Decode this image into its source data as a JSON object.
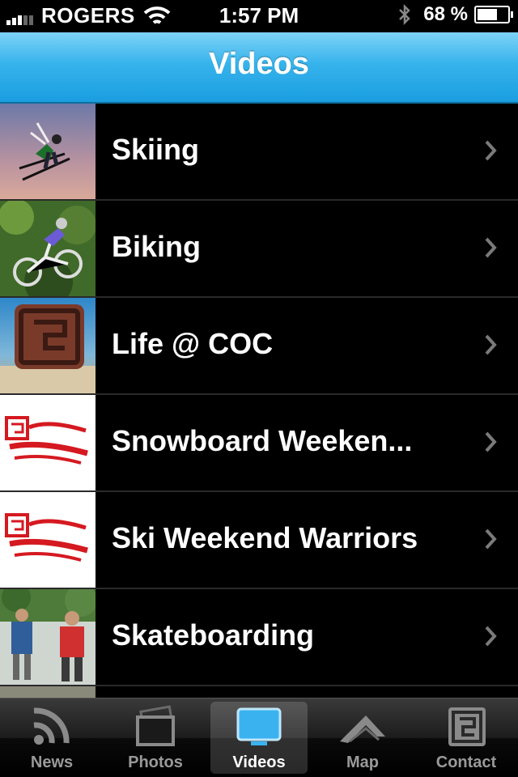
{
  "status_bar": {
    "carrier": "ROGERS",
    "time": "1:57 PM",
    "battery_percent": "68 %",
    "battery_level": 0.68
  },
  "nav": {
    "title": "Videos"
  },
  "list": {
    "items": [
      {
        "label": "Skiing",
        "thumbnail": "skier-jump-photo"
      },
      {
        "label": "Biking",
        "thumbnail": "mountain-biker-photo"
      },
      {
        "label": "Life @ COC",
        "thumbnail": "coc-logo-sign-photo"
      },
      {
        "label": "Snowboard Weeken...",
        "thumbnail": "weekend-warriors-logo"
      },
      {
        "label": "Ski Weekend Warriors",
        "thumbnail": "weekend-warriors-logo"
      },
      {
        "label": "Skateboarding",
        "thumbnail": "skateboarders-photo"
      }
    ]
  },
  "tab_bar": {
    "tabs": [
      {
        "label": "News",
        "icon": "rss-icon"
      },
      {
        "label": "Photos",
        "icon": "photos-icon"
      },
      {
        "label": "Videos",
        "icon": "tv-icon",
        "active": true
      },
      {
        "label": "Map",
        "icon": "mountain-icon"
      },
      {
        "label": "Contact",
        "icon": "coc-logo-icon"
      }
    ]
  },
  "colors": {
    "nav_blue": "#1a9ee0",
    "logo_red": "#d51920"
  }
}
